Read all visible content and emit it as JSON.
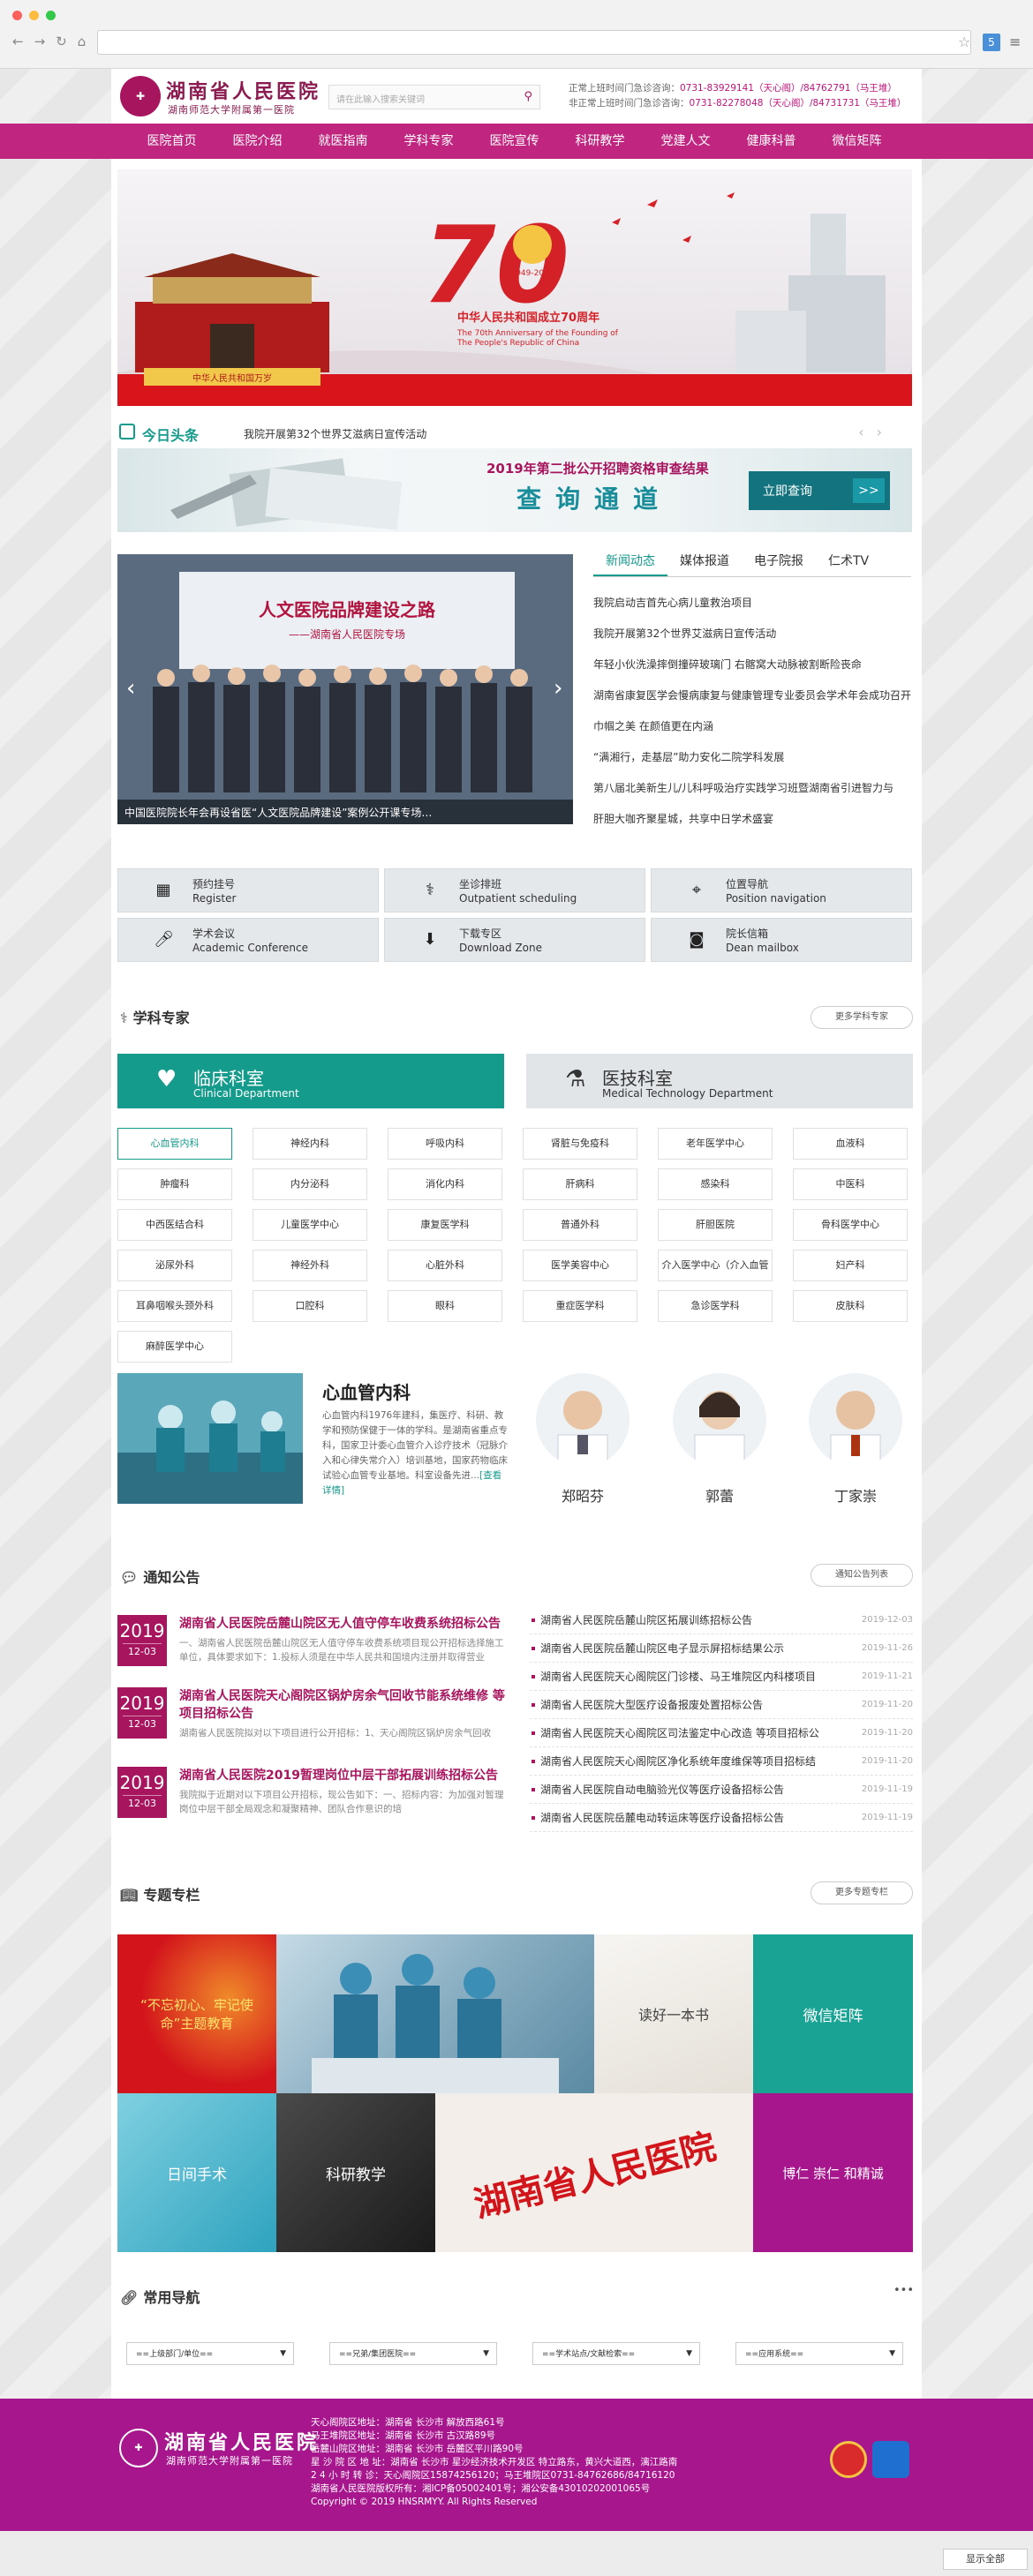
{
  "colors": {
    "brand": "#c0257f",
    "brand_dark": "#a8155f",
    "teal": "#159b8c"
  },
  "header": {
    "logo_title": "湖南省人民医院",
    "logo_subtitle": "湖南师范大学附属第一医院",
    "search_placeholder": "请在此输入搜索关键词",
    "hotline": [
      {
        "label": "正常上班时间门急诊咨询：",
        "phone": "0731-83929141（天心阁）/84762791（马王堆）"
      },
      {
        "label": "非正常上班时间门急诊咨询：",
        "phone": "0731-82278048（天心阁）/84731731（马王堆）"
      }
    ]
  },
  "nav": [
    "医院首页",
    "医院介绍",
    "就医指南",
    "学科专家",
    "医院宣传",
    "科研教学",
    "党建人文",
    "健康科普",
    "微信矩阵"
  ],
  "banner": {
    "title": "中华人民共和国成立70周年",
    "subtitle1": "The 70th Anniversary of the Founding of",
    "subtitle2": "The People's Republic of China",
    "numeral": "70",
    "years": "1949-2019",
    "gate_text": "中华人民共和国万岁"
  },
  "headline": {
    "label": "今日头条",
    "text": "我院开展第32个世界艾滋病日宣传活动"
  },
  "recruit": {
    "title": "2019年第二批公开招聘资格审查结果",
    "big": "查询通道",
    "button": "立即查询",
    "arrow": ">>"
  },
  "photo": {
    "caption": "中国医院院长年会再设省医“人文医院品牌建设”案例公开课专场…",
    "board": "人文医院品牌建设之路",
    "board_sub": "——湖南省人民医院专场"
  },
  "news_tabs": [
    "新闻动态",
    "媒体报道",
    "电子院报",
    "仁术TV"
  ],
  "news_list": [
    "我院启动吉首先心病儿童救治项目",
    "我院开展第32个世界艾滋病日宣传活动",
    "年轻小伙洗澡摔倒撞碎玻璃门 右髂窝大动脉被割断险丧命",
    "湖南省康复医学会慢病康复与健康管理专业委员会学术年会成功召开",
    "巾帼之美 在颜值更在内涵",
    "“满湘行，走基层”助力安化二院学科发展",
    "第八届北美新生儿/儿科呼吸治疗实践学习班暨湖南省引进智力与",
    "肝胆大咖齐聚星城，共享中日学术盛宴"
  ],
  "quick": [
    {
      "icon": "qr",
      "zh": "预约挂号",
      "en": "Register"
    },
    {
      "icon": "steth",
      "zh": "坐诊排班",
      "en": "Outpatient scheduling"
    },
    {
      "icon": "pin",
      "zh": "位置导航",
      "en": "Position navigation"
    },
    {
      "icon": "mic",
      "zh": "学术会议",
      "en": "Academic Conference"
    },
    {
      "icon": "dl",
      "zh": "下载专区",
      "en": "Download Zone"
    },
    {
      "icon": "cam",
      "zh": "院长信箱",
      "en": "Dean mailbox"
    }
  ],
  "experts": {
    "title": "学科专家",
    "more": "更多学科专家",
    "tab1_zh": "临床科室",
    "tab1_en": "Clinical Department",
    "tab2_zh": "医技科室",
    "tab2_en": "Medical Technology Department",
    "departments": [
      "心血管内科",
      "神经内科",
      "呼吸内科",
      "肾脏与免疫科",
      "老年医学中心",
      "血液科",
      "肿瘤科",
      "内分泌科",
      "消化内科",
      "肝病科",
      "感染科",
      "中医科",
      "中西医结合科",
      "儿童医学中心",
      "康复医学科",
      "普通外科",
      "肝胆医院",
      "骨科医学中心",
      "泌尿外科",
      "神经外科",
      "心脏外科",
      "医学美容中心",
      "介入医学中心（介入血管",
      "妇产科",
      "耳鼻咽喉头颈外科",
      "口腔科",
      "眼科",
      "重症医学科",
      "急诊医学科",
      "皮肤科",
      "麻醉医学中心"
    ],
    "dept_title": "心血管内科",
    "dept_desc": "心血管内科1976年建科，集医疗、科研、教学和预防保健于一体的学科。是湖南省重点专科，国家卫计委心血管介入诊疗技术（冠脉介入和心律失常介入）培训基地，国家药物临床试验心血管专业基地。科室设备先进...",
    "dept_link": "[查看详情]",
    "doctors": [
      "郑昭芬",
      "郭蕾",
      "丁家崇"
    ]
  },
  "notices": {
    "title": "通知公告",
    "more": "通知公告列表",
    "featured": [
      {
        "y": "2019",
        "md": "12-03",
        "t": "湖南省人民医院岳麓山院区无人值守停车收费系统招标公告",
        "d": "一、湖南省人民医院岳麓山院区无人值守停车收费系统项目现公开招标选择施工单位，具体要求如下：1.投标人须是在中华人民共和国境内注册并取得营业"
      },
      {
        "y": "2019",
        "md": "12-03",
        "t": "湖南省人民医院天心阁院区锅炉房余气回收节能系统维修 等项目招标公告",
        "d": "湖南省人民医院拟对以下项目进行公开招标：1、天心阁院区锅炉房余气回收"
      },
      {
        "y": "2019",
        "md": "12-03",
        "t": "湖南省人民医院2019暂理岗位中层干部拓展训练招标公告",
        "d": "我院拟于近期对以下项目公开招标，现公告如下：一、招标内容：为加强对暂理岗位中层干部全局观念和凝聚精神、团队合作意识的培"
      }
    ],
    "list": [
      {
        "t": "湖南省人民医院岳麓山院区拓展训练招标公告",
        "d": "2019-12-03"
      },
      {
        "t": "湖南省人民医院岳麓山院区电子显示屏招标结果公示",
        "d": "2019-11-26"
      },
      {
        "t": "湖南省人民医院天心阁院区门诊楼、马王堆院区内科楼项目",
        "d": "2019-11-21"
      },
      {
        "t": "湖南省人民医院大型医疗设备报废处置招标公告",
        "d": "2019-11-20"
      },
      {
        "t": "湖南省人民医院天心阁院区司法鉴定中心改造 等项目招标公",
        "d": "2019-11-20"
      },
      {
        "t": "湖南省人民医院天心阁院区净化系统年度维保等项目招标结",
        "d": "2019-11-20"
      },
      {
        "t": "湖南省人民医院自动电脑验光仪等医疗设备招标公告",
        "d": "2019-11-19"
      },
      {
        "t": "湖南省人民医院岳麓电动转运床等医疗设备招标公告",
        "d": "2019-11-19"
      }
    ]
  },
  "topics": {
    "title": "专题专栏",
    "more": "更多专题专栏",
    "tiles": [
      "“不忘初心、牢记使命”主题教育",
      "读好一本书",
      "微信矩阵",
      "日间手术",
      "科研教学",
      "湖南省人民医院",
      "博仁 崇仁 和精诚"
    ]
  },
  "links": {
    "title": "常用导航",
    "more": "•••",
    "selects": [
      "==上级部门/单位==",
      "==兄弟/集团医院==",
      "==学术站点/文献检索==",
      "==应用系统=="
    ]
  },
  "footer": {
    "title": "湖南省人民医院",
    "subtitle": "湖南师范大学附属第一医院",
    "lines": [
      "天心阁院区地址：湖南省 长沙市 解放西路61号",
      "马王堆院区地址：湖南省 长沙市 古汉路89号",
      "岳麓山院区地址：湖南省 长沙市 岳麓区平川路90号",
      "星 沙 院 区 地 址：湖南省 长沙市 星沙经济技术开发区 特立路东，黄兴大道西，漓江路南",
      "2 4 小 时 转 诊：天心阁院区15874256120；马王堆院区0731-84762686/84716120",
      "湖南省人民医院版权所有：湘ICP备05002401号；湘公安备43010202001065号",
      "Copyright © 2019 HNSRMYY. All Rights Reserved"
    ]
  },
  "status": {
    "show_all": "显示全部"
  }
}
